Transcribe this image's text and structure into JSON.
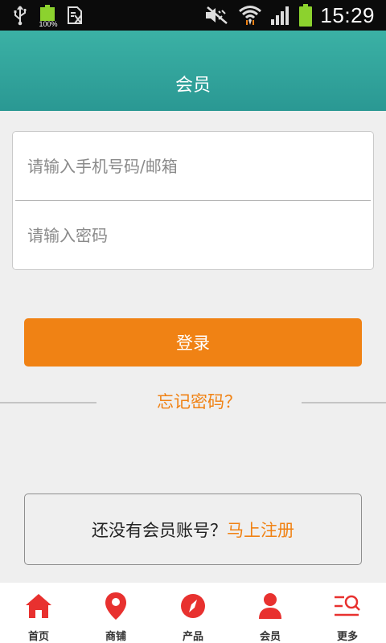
{
  "status_bar": {
    "battery_small_label": "100%",
    "time": "15:29",
    "icons": [
      "usb-icon",
      "battery-icon",
      "document-icon",
      "mute-icon",
      "wifi-icon",
      "signal-icon",
      "battery-icon"
    ]
  },
  "header": {
    "title": "会员"
  },
  "login_form": {
    "account_placeholder": "请输入手机号码/邮箱",
    "password_placeholder": "请输入密码",
    "login_label": "登录"
  },
  "forgot_password": "忘记密码？",
  "register": {
    "prompt": "还没有会员账号？",
    "link": "马上注册"
  },
  "tabbar": {
    "items": [
      {
        "label": "首页",
        "icon": "home-icon"
      },
      {
        "label": "商铺",
        "icon": "location-pin-icon"
      },
      {
        "label": "产品",
        "icon": "compass-icon"
      },
      {
        "label": "会员",
        "icon": "user-icon"
      },
      {
        "label": "更多",
        "icon": "more-menu-search-icon"
      }
    ]
  },
  "colors": {
    "accent": "#f08214",
    "header": "#33a69d",
    "nav_icon": "#e8312f"
  }
}
